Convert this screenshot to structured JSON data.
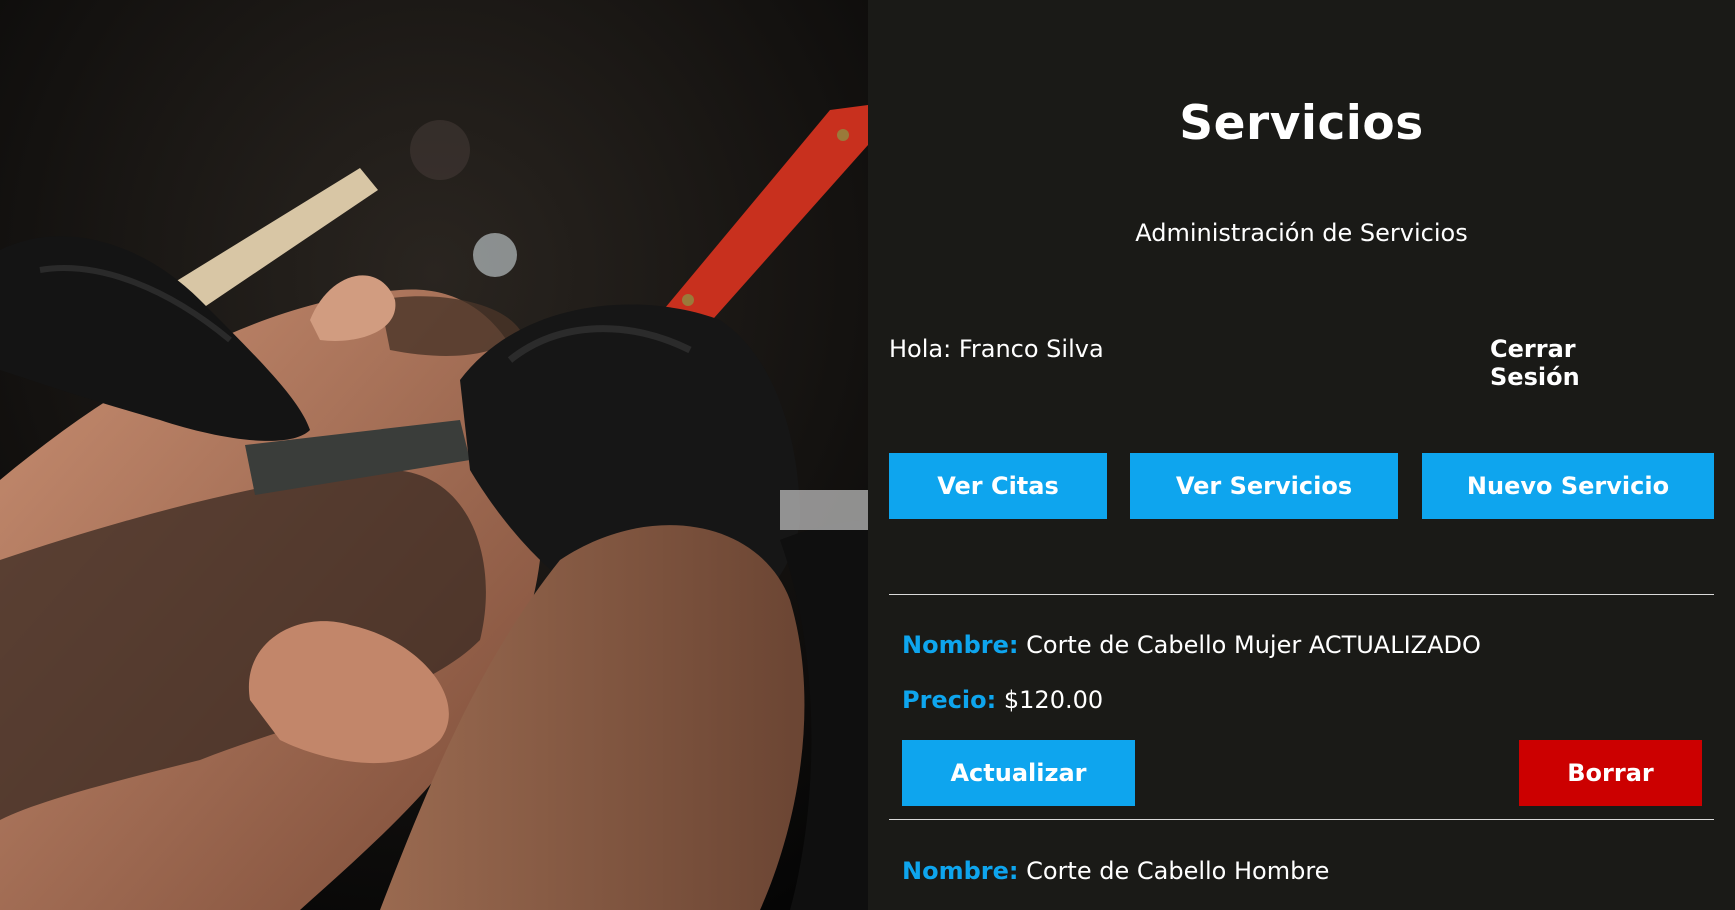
{
  "header": {
    "title": "Servicios",
    "subtitle": "Administración de Servicios"
  },
  "session": {
    "greeting": "Hola: Franco Silva",
    "logout_label": "Cerrar Sesión"
  },
  "nav": {
    "ver_citas": "Ver Citas",
    "ver_servicios": "Ver Servicios",
    "nuevo_servicio": "Nuevo Servicio"
  },
  "labels": {
    "nombre": "Nombre:",
    "precio": "Precio:"
  },
  "services": [
    {
      "nombre": "Corte de Cabello Mujer ACTUALIZADO",
      "precio": "$120.00",
      "actualizar_label": "Actualizar",
      "borrar_label": "Borrar"
    },
    {
      "nombre": "Corte de Cabello Hombre"
    }
  ],
  "colors": {
    "background": "#1a1a17",
    "accent": "#0ea5ee",
    "danger": "#cc0000",
    "text": "#ffffff"
  }
}
